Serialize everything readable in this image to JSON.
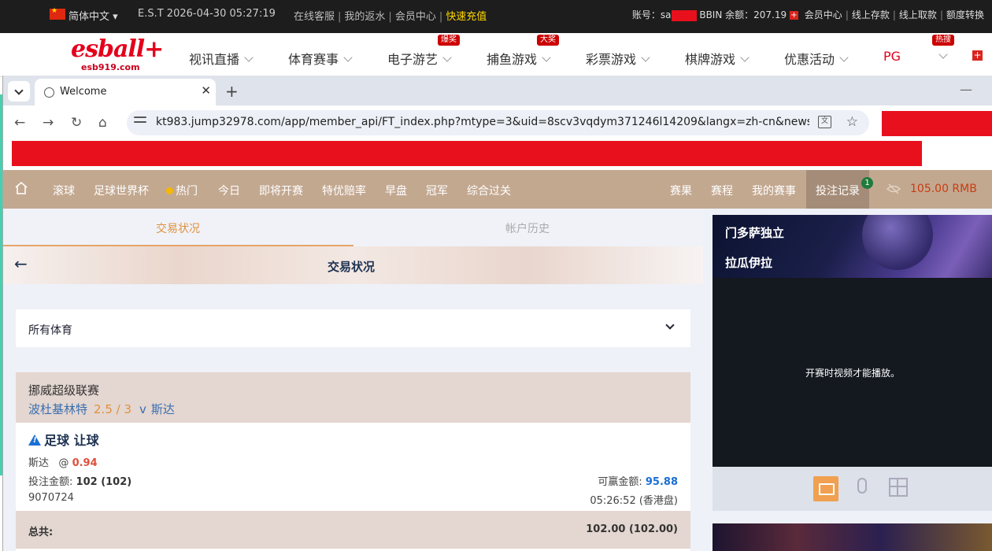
{
  "topbar": {
    "language": "简体中文 ▾",
    "time": "E.S.T 2026-04-30 05:27:19",
    "links": [
      "在线客服",
      "我的返水",
      "会员中心"
    ],
    "highlight_link": "快速充值",
    "account_label": "账号：sa",
    "balance_label": "BBIN 余额：207.19",
    "right_links": [
      "会员中心",
      "线上存款",
      "线上取款",
      "额度转换"
    ]
  },
  "sitenav": {
    "logo_main": "esball+",
    "logo_sub": "esb919.com",
    "items": [
      {
        "label": "视讯直播"
      },
      {
        "label": "体育赛事"
      },
      {
        "label": "电子游艺",
        "badge": "爆奖"
      },
      {
        "label": "捕鱼游戏",
        "badge": "大奖"
      },
      {
        "label": "彩票游戏"
      },
      {
        "label": "棋牌游戏"
      },
      {
        "label": "优惠活动"
      },
      {
        "label": "PG"
      }
    ],
    "extra_badge": "热搜"
  },
  "browser": {
    "tab_title": "Welcome",
    "url": "kt983.jump32978.com/app/member_api/FT_index.php?mtype=3&uid=8scv3vqdym371246l14209&langx=zh-cn&news_m..."
  },
  "mainnav": {
    "items": [
      "滚球",
      "足球世界杯",
      "热门",
      "今日",
      "即将开赛",
      "特优赔率",
      "早盘",
      "冠军",
      "综合过关"
    ],
    "right_items": [
      "赛果",
      "赛程",
      "我的赛事"
    ],
    "bet_record": "投注记录",
    "bet_count": "1",
    "balance": "105.00  RMB"
  },
  "subtabs": {
    "active": "交易状况",
    "inactive": "帐户历史"
  },
  "page_title": "交易状况",
  "filter": {
    "label": "所有体育"
  },
  "bet": {
    "league": "挪威超级联赛",
    "home": "波杜基林特",
    "handicap": "2.5 / 3",
    "vs": "v",
    "away": "斯达",
    "type": "足球 让球",
    "selection": "斯达",
    "odds_prefix": "@",
    "odds": "0.94",
    "stake_label": "投注金额:",
    "stake_value": "102 (102)",
    "win_label": "可赢金额:",
    "win_value": "95.88",
    "ticket_id": "9070724",
    "bet_time": "05:26:52 (香港盘)",
    "total_label": "总共:",
    "total_value": "102.00 (102.00)"
  },
  "sidebar": {
    "team1": "门多萨独立",
    "team2": "拉瓜伊拉",
    "video_message": "开赛时视频才能播放。"
  }
}
